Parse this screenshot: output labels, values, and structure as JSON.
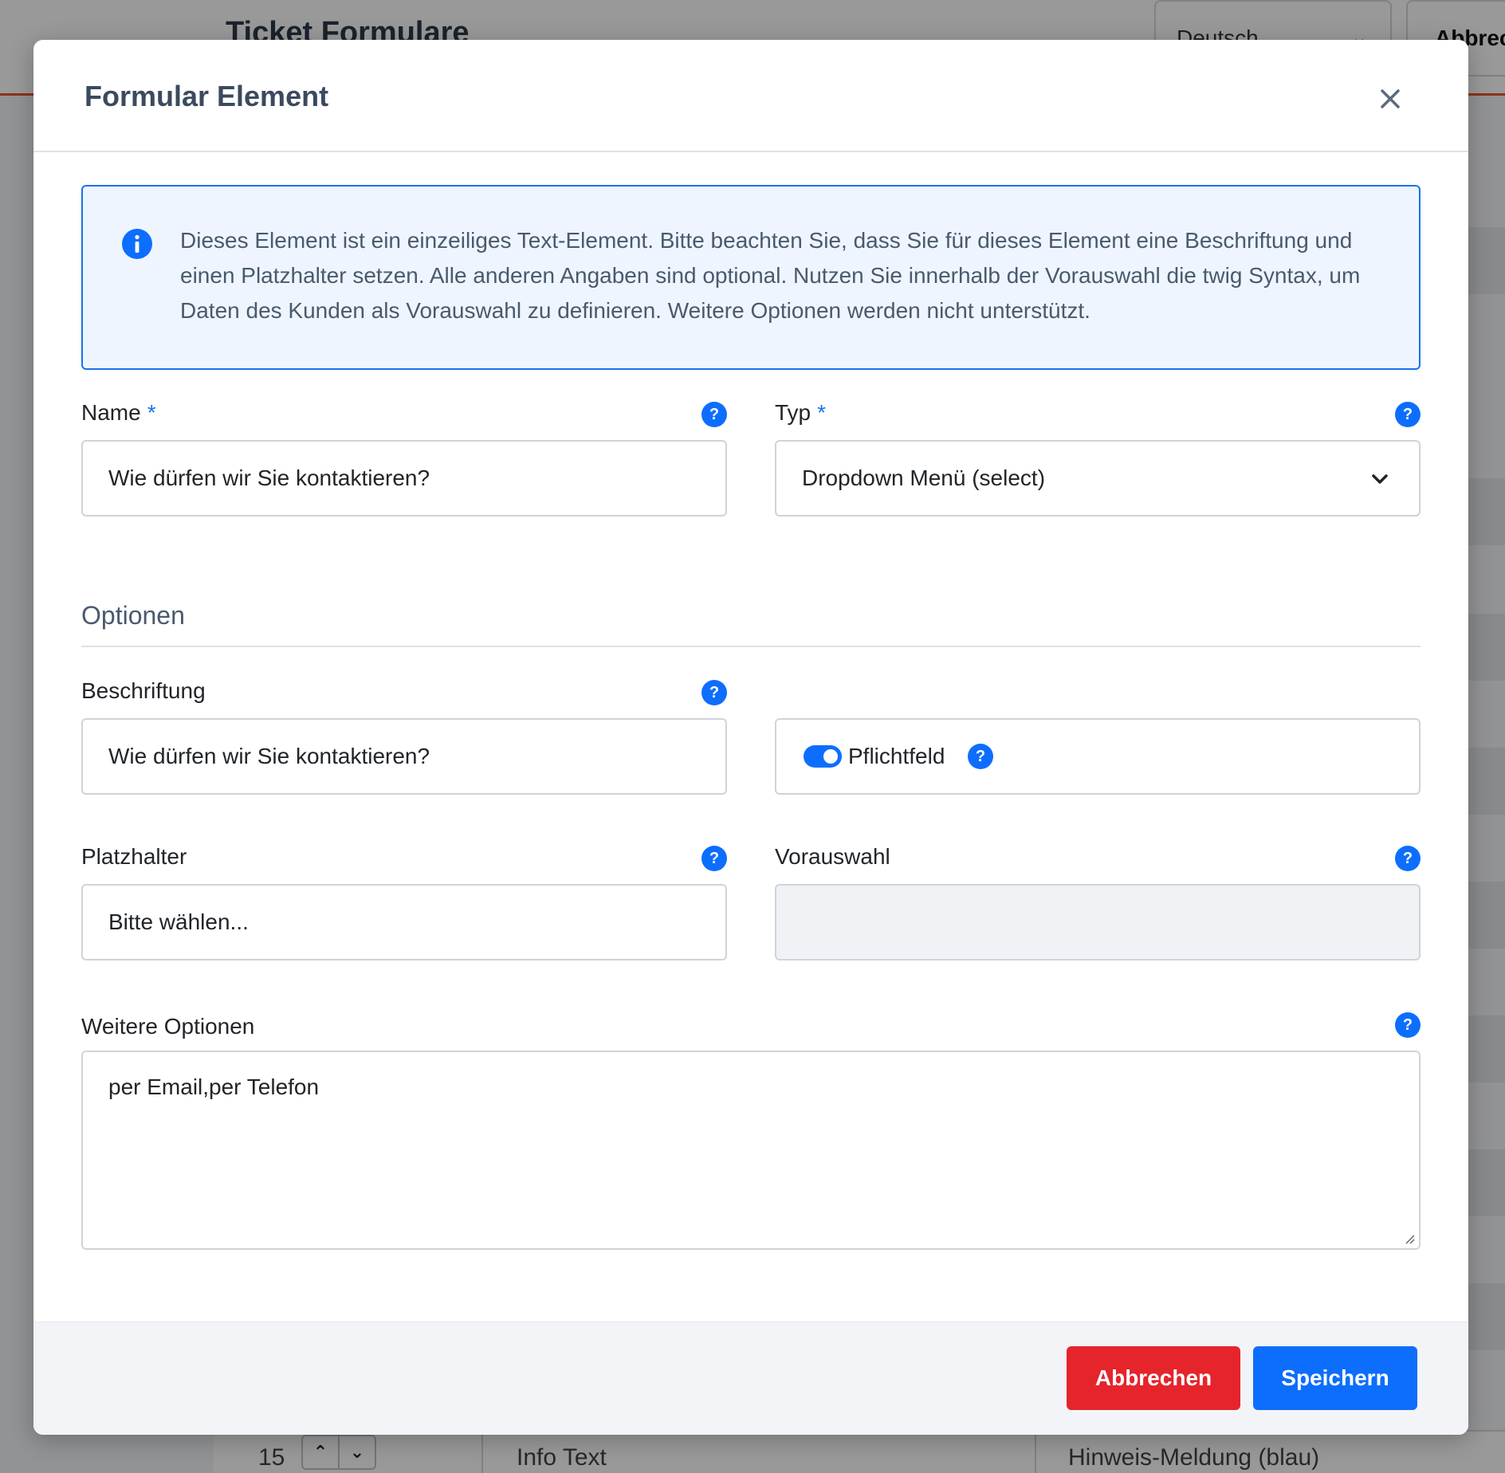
{
  "background": {
    "page_title": "Ticket Formulare",
    "language_select": "Deutsch",
    "cancel_button": "Abbrec",
    "table_row": {
      "number": "15",
      "type": "Info Text",
      "style": "Hinweis-Meldung (blau)"
    }
  },
  "modal": {
    "title": "Formular Element",
    "info": "Dieses Element ist ein einzeiliges Text-Element. Bitte beachten Sie, dass Sie für dieses Element eine Beschriftung und einen Platzhalter setzen. Alle anderen Angaben sind optional. Nutzen Sie innerhalb der Vorauswahl die twig Syntax, um Daten des Kunden als Vorauswahl zu definieren. Weitere Optionen werden nicht unterstützt.",
    "name": {
      "label": "Name",
      "required_mark": "*",
      "value": "Wie dürfen wir Sie kontaktieren?"
    },
    "type": {
      "label": "Typ",
      "required_mark": "*",
      "value": "Dropdown Menü (select)"
    },
    "options_section": "Optionen",
    "caption": {
      "label": "Beschriftung",
      "value": "Wie dürfen wir Sie kontaktieren?"
    },
    "required_toggle": {
      "label": "Pflichtfeld",
      "checked": true
    },
    "placeholder": {
      "label": "Platzhalter",
      "value": "Bitte wählen..."
    },
    "preselection": {
      "label": "Vorauswahl",
      "value": ""
    },
    "more_options": {
      "label": "Weitere Optionen",
      "value": "per Email,per Telefon"
    },
    "help_glyph": "?",
    "footer": {
      "cancel": "Abbrechen",
      "save": "Speichern"
    }
  },
  "colors": {
    "primary": "#0d6efd",
    "danger": "#e5242b",
    "info_bg": "#eef5ff"
  }
}
